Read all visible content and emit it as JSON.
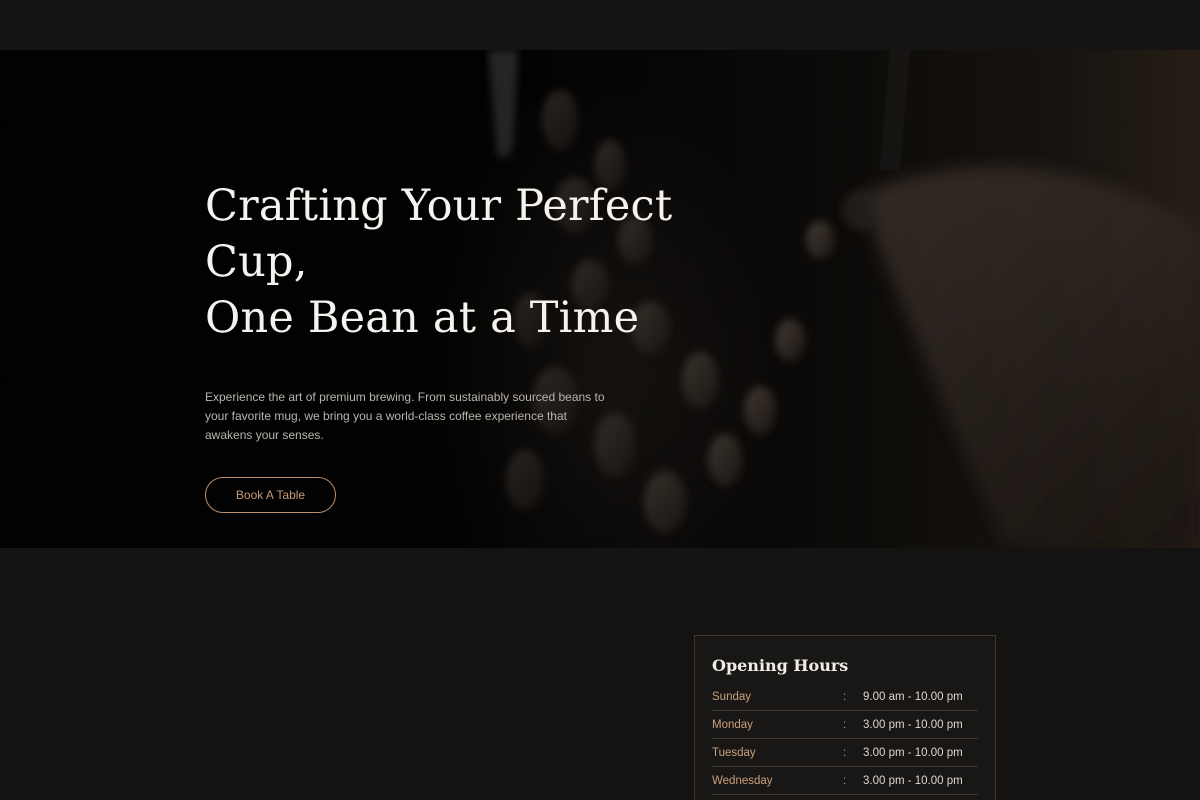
{
  "hero": {
    "title_line1": "Crafting Your Perfect Cup,",
    "title_line2": "One Bean at a Time",
    "description": "Experience the art of premium brewing. From sustainably sourced beans to your favorite mug, we bring you a world-class coffee experience that awakens your senses.",
    "cta_label": "Book A Table",
    "background_icon": "coffee-beans-image"
  },
  "opening_hours": {
    "title": "Opening Hours",
    "rows": [
      {
        "day": "Sunday",
        "separator": ":",
        "time": "9.00 am - 10.00 pm"
      },
      {
        "day": "Monday",
        "separator": ":",
        "time": "3.00 pm - 10.00 pm"
      },
      {
        "day": "Tuesday",
        "separator": ":",
        "time": "3.00 pm - 10.00 pm"
      },
      {
        "day": "Wednesday",
        "separator": ":",
        "time": "3.00 pm - 10.00 pm"
      }
    ]
  },
  "colors": {
    "background": "#141312",
    "accent": "#c79b78",
    "text": "#f6f3ee",
    "muted_text": "#b9b4ad",
    "card_border": "#3c3935"
  }
}
